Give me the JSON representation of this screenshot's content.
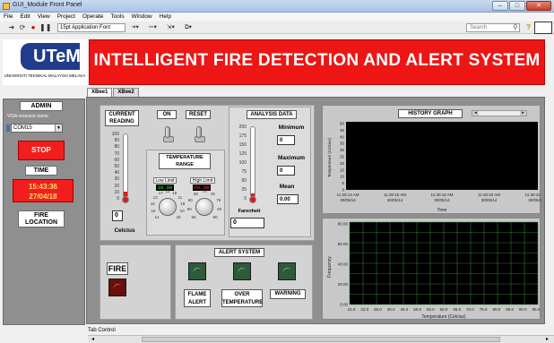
{
  "window": {
    "title": "GUI_Module Front Panel",
    "buttons": {
      "minimize": "–",
      "maximize": "□",
      "close": "✕"
    }
  },
  "menu": [
    "File",
    "Edit",
    "View",
    "Project",
    "Operate",
    "Tools",
    "Window",
    "Help"
  ],
  "toolbar": {
    "font": "15pt Application Font",
    "search_placeholder": "Search"
  },
  "logo": {
    "text": "UTeM",
    "subtitle": "UNIVERSITI TEKNIKAL MALAYSIA MELAKA"
  },
  "banner": {
    "title": "INTELLIGENT FIRE DETECTION AND ALERT SYSTEM",
    "color": "#ee1515"
  },
  "tabs": [
    {
      "label": "XBee1",
      "active": true
    },
    {
      "label": "XBee2",
      "active": false
    }
  ],
  "left": {
    "admin_label": "ADMIN",
    "visa_label": "VISA resource name",
    "visa_value": "COM15",
    "stop_label": "STOP",
    "time_label": "TIME",
    "time_value": "15:43:36",
    "date_value": "27/04/18",
    "fire_location_label": "FIRE LOCATION"
  },
  "current_reading": {
    "title": "CURRENT READING",
    "scale": [
      "100",
      "90",
      "80",
      "70",
      "60",
      "50",
      "40",
      "30",
      "20",
      "10",
      "0"
    ],
    "level": 0.08,
    "value": "0",
    "unit": "Celcius"
  },
  "controls": {
    "on_label": "ON",
    "reset_label": "RESET"
  },
  "temperature_range": {
    "title": "TEMPERATURE RANGE",
    "low": {
      "label": "Low Limit",
      "value": "10.00",
      "scale": [
        "14",
        "15",
        "16",
        "13",
        "17",
        "12",
        "18",
        "11",
        "19",
        "10",
        "20"
      ]
    },
    "high": {
      "label": "High Limit",
      "value": "60.00",
      "scale": [
        "55",
        "60",
        "50",
        "65",
        "70",
        "45",
        "75",
        "40",
        "80"
      ]
    }
  },
  "analysis": {
    "title": "ANALYSIS DATA",
    "scale": [
      "200",
      "175",
      "150",
      "125",
      "100",
      "75",
      "50",
      "25",
      "0"
    ],
    "level": 0.05,
    "min_label": "Minimum",
    "min_value": "0",
    "max_label": "Maximum",
    "max_value": "0",
    "mean_label": "Mean",
    "mean_value": "0.00",
    "fahrenheit_label": "Farenheit",
    "fahrenheit_value": "0"
  },
  "history_graph": {
    "title": "HISTORY GRAPH",
    "ylabel": "Temperature (Celcius)",
    "xlabel": "Time",
    "yticks": [
      "50",
      "45",
      "40",
      "35",
      "30",
      "25",
      "20",
      "15",
      "10",
      "5",
      "0"
    ],
    "xticks": [
      {
        "time": "11:30:14 AM",
        "date": "30/05/14"
      },
      {
        "time": "11:30:16 AM",
        "date": "30/05/14"
      },
      {
        "time": "11:30:18 AM",
        "date": "30/05/14"
      },
      {
        "time": "11:30:20 AM",
        "date": "30/05/14"
      },
      {
        "time": "11:30:22 AM",
        "date": "30/05/14"
      }
    ]
  },
  "histogram": {
    "ylabel": "Frequency",
    "xlabel": "Temperature (Celcius)",
    "yticks": [
      "80.00",
      "60.00",
      "40.00",
      "20.00",
      "0.00"
    ],
    "xticks": [
      "24.0",
      "32.0",
      "35.0",
      "40.0",
      "45.0",
      "50.0",
      "55.0",
      "60.0",
      "65.0",
      "70.0",
      "75.0",
      "80.0",
      "85.0",
      "90.0",
      "95.0"
    ]
  },
  "alert": {
    "title": "ALERT SYSTEM",
    "fire_label": "FIRE",
    "flame_label": "FLAME ALERT",
    "overtemp_label": "OVER TEMPERATURE",
    "warning_label": "WARNING"
  },
  "tab_control_label": "Tab Control"
}
